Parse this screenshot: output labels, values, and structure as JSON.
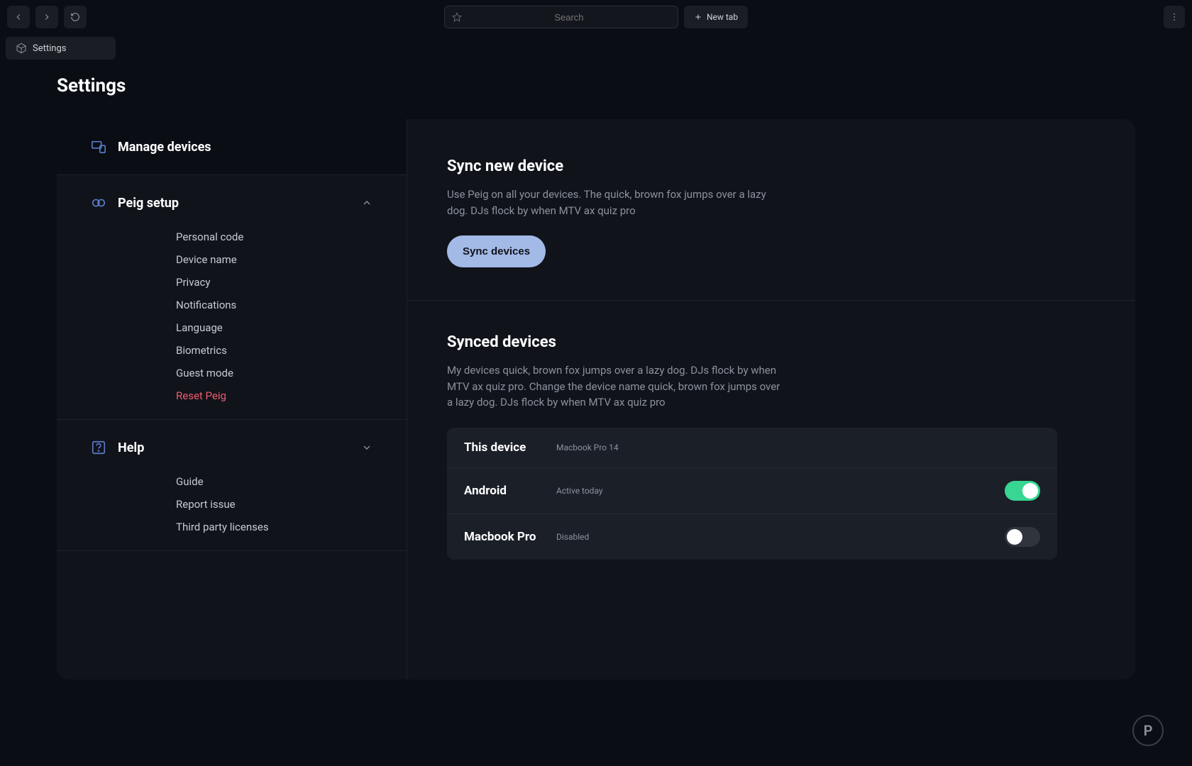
{
  "topbar": {
    "search_placeholder": "Search",
    "newtab_label": "New tab"
  },
  "tab": {
    "label": "Settings"
  },
  "page_title": "Settings",
  "sidebar": {
    "sections": [
      {
        "title": "Manage devices",
        "icon": "devices",
        "active": true
      },
      {
        "title": "Peig setup",
        "icon": "link",
        "expanded": true,
        "items": [
          "Personal code",
          "Device name",
          "Privacy",
          "Notifications",
          "Language",
          "Biometrics",
          "Guest mode"
        ],
        "danger_item": "Reset Peig"
      },
      {
        "title": "Help",
        "icon": "help",
        "expanded": false,
        "items": [
          "Guide",
          "Report issue",
          "Third party licenses"
        ]
      }
    ]
  },
  "sync_new": {
    "title": "Sync new device",
    "desc": "Use Peig on all your devices. The quick, brown fox jumps over a lazy dog. DJs flock by when MTV ax quiz pro",
    "button": "Sync devices"
  },
  "synced": {
    "title": "Synced devices",
    "desc": "My devices quick, brown fox jumps over a lazy dog. DJs flock by when MTV ax quiz pro. Change the device name quick, brown fox jumps over a lazy dog. DJs flock by when MTV ax quiz pro",
    "devices": [
      {
        "name": "This device",
        "meta": "Macbook Pro 14",
        "toggle": null
      },
      {
        "name": "Android",
        "meta": "Active today",
        "toggle": true
      },
      {
        "name": "Macbook Pro",
        "meta": "Disabled",
        "toggle": false
      }
    ]
  },
  "fab_glyph": "P"
}
